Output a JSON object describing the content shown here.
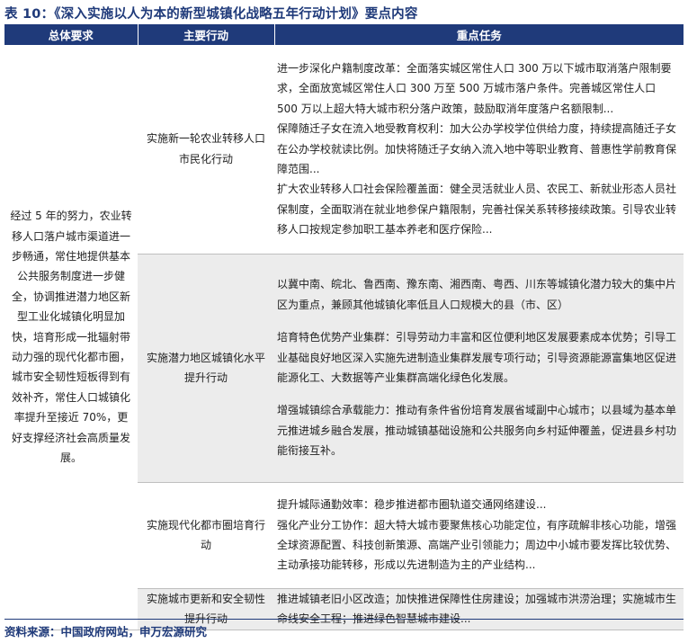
{
  "title": "表 10：《深入实施以人为本的新型城镇化战略五年行动计划》要点内容",
  "columns": [
    "总体要求",
    "主要行动",
    "重点任务"
  ],
  "summary": "经过 5 年的努力，农业转移人口落户城市渠道进一步畅通，常住地提供基本公共服务制度进一步健全，协调推进潜力地区新型工业化城镇化明显加快，培育形成一批辐射带动力强的现代化都市圈，城市安全韧性短板得到有效补齐，常住人口城镇化率提升至接近 70%，更好支撑经济社会高质量发展。",
  "rows": [
    {
      "action": "实施新一轮农业转移人口市民化行动",
      "tasks": [
        "进一步深化户籍制度改革：全面落实城区常住人口 300 万以下城市取消落户限制要求，全面放宽城区常住人口 300 万至 500 万城市落户条件。完善城区常住人口 500 万以上超大特大城市积分落户政策，鼓励取消年度落户名额限制...",
        "保障随迁子女在流入地受教育权利：加大公办学校学位供给力度，持续提高随迁子女在公办学校就读比例。加快将随迁子女纳入流入地中等职业教育、普惠性学前教育保障范围...",
        "扩大农业转移人口社会保险覆盖面：健全灵活就业人员、农民工、新就业形态人员社保制度，全面取消在就业地参保户籍限制，完善社保关系转移接续政策。引导农业转移人口按规定参加职工基本养老和医疗保险..."
      ]
    },
    {
      "action": "实施潜力地区城镇化水平提升行动",
      "tasks": [
        "以冀中南、皖北、鲁西南、豫东南、湘西南、粤西、川东等城镇化潜力较大的集中片区为重点，兼顾其他城镇化率低且人口规模大的县（市、区）",
        "培育特色优势产业集群：引导劳动力丰富和区位便利地区发展要素成本优势；引导工业基础良好地区深入实施先进制造业集群发展专项行动；引导资源能源富集地区促进能源化工、大数据等产业集群高端化绿色化发展。",
        "增强城镇综合承载能力：推动有条件省份培育发展省域副中心城市；以县域为基本单元推进城乡融合发展，推动城镇基础设施和公共服务向乡村延伸覆盖，促进县乡村功能衔接互补。"
      ]
    },
    {
      "action": "实施现代化都市圈培育行动",
      "tasks": [
        "提升城际通勤效率：稳步推进都市圈轨道交通网络建设...",
        "强化产业分工协作：超大特大城市要聚焦核心功能定位，有序疏解非核心功能，增强全球资源配置、科技创新策源、高端产业引领能力；周边中小城市要发挥比较优势、主动承接功能转移，形成以先进制造为主的产业结构..."
      ]
    },
    {
      "action": "实施城市更新和安全韧性提升行动",
      "tasks": [
        "推进城镇老旧小区改造；加快推进保障性住房建设；加强城市洪涝治理；实施城市生命线安全工程；推进绿色智慧城市建设..."
      ]
    }
  ],
  "source": "资料来源：中国政府网站，申万宏源研究",
  "colors": {
    "header_bg": "#1f3a7a",
    "title_text": "#1f3a7a",
    "shaded_row_bg": "#ececec"
  }
}
